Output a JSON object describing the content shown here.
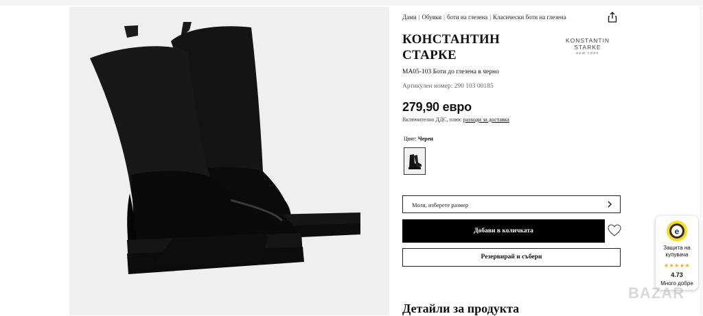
{
  "breadcrumb": [
    "Дами",
    "Обувки",
    "боти на глезена",
    "Класически боти на глезена"
  ],
  "product": {
    "brand": "КОНСТАНТИН СТАРКЕ",
    "logo_line1": "KONSTANTIN STARKE",
    "logo_line2": "NEW YORK",
    "name": "MA05-103 Боти до глезена в черно",
    "article_number": "Артикулен номер: 290 103 00185",
    "price": "279,90 евро",
    "vat_text": "Включително ДДС, плюс",
    "shipping_link": "разходи за доставка",
    "color_label": "Цвят:",
    "color_value": "Черен"
  },
  "actions": {
    "size_placeholder": "Моля, изберете размер",
    "add_to_cart": "Добави в количката",
    "reserve": "Резервирай и събери"
  },
  "details_title": "Детайли за продукта",
  "trust_badge": {
    "text": "Защита на купувача",
    "rating": "4.73",
    "rating_label": "Много добре",
    "stars": "★★★★★"
  },
  "watermark": "BAZAR",
  "icons": {
    "share": "share-icon",
    "chevron": "chevron-right-icon",
    "heart": "heart-icon"
  }
}
